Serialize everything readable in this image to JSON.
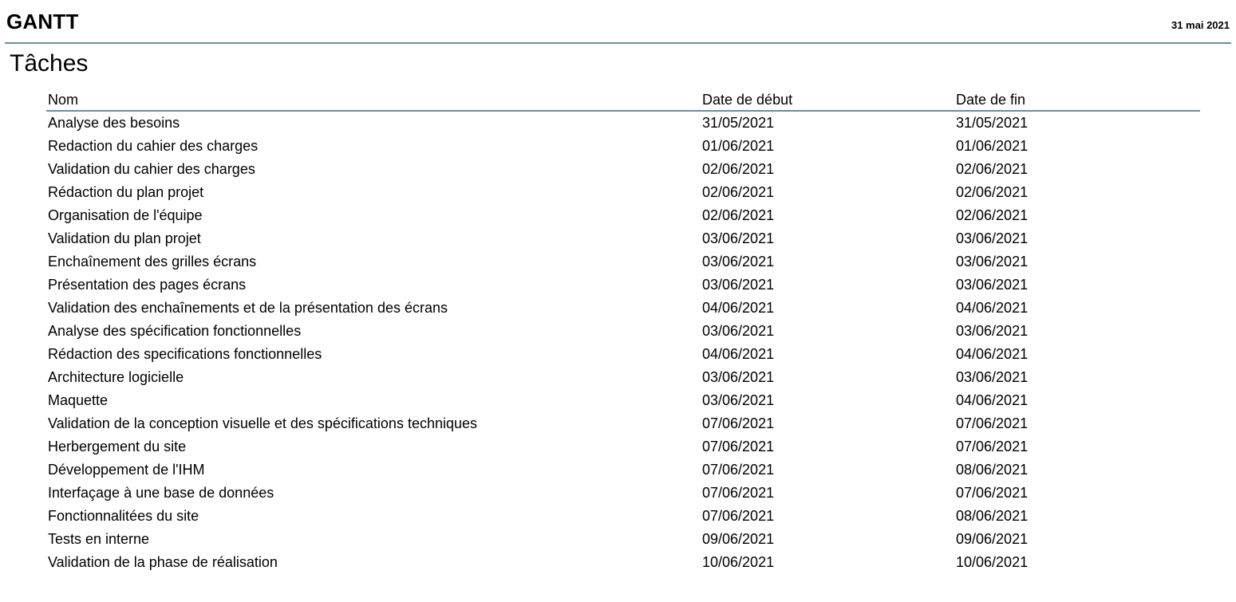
{
  "header": {
    "title": "GANTT",
    "date": "31 mai 2021"
  },
  "section": {
    "title": "Tâches"
  },
  "table": {
    "columns": [
      "Nom",
      "Date de début",
      "Date de fin"
    ],
    "rows": [
      [
        "Analyse des besoins",
        "31/05/2021",
        "31/05/2021"
      ],
      [
        "Redaction du cahier des charges",
        "01/06/2021",
        "01/06/2021"
      ],
      [
        "Validation du cahier des charges",
        "02/06/2021",
        "02/06/2021"
      ],
      [
        "Rédaction du plan projet",
        "02/06/2021",
        "02/06/2021"
      ],
      [
        "Organisation de l'équipe",
        "02/06/2021",
        "02/06/2021"
      ],
      [
        "Validation du plan projet",
        "03/06/2021",
        "03/06/2021"
      ],
      [
        "Enchaînement des grilles écrans",
        "03/06/2021",
        "03/06/2021"
      ],
      [
        "Présentation des pages écrans",
        "03/06/2021",
        "03/06/2021"
      ],
      [
        "Validation des enchaînements et de la présentation des écrans",
        "04/06/2021",
        "04/06/2021"
      ],
      [
        "Analyse des spécification fonctionnelles",
        "03/06/2021",
        "03/06/2021"
      ],
      [
        "Rédaction des specifications fonctionnelles",
        "04/06/2021",
        "04/06/2021"
      ],
      [
        "Architecture logicielle",
        "03/06/2021",
        "03/06/2021"
      ],
      [
        "Maquette",
        "03/06/2021",
        "04/06/2021"
      ],
      [
        "Validation de la conception visuelle et des spécifications techniques",
        "07/06/2021",
        "07/06/2021"
      ],
      [
        "Herbergement du site",
        "07/06/2021",
        "07/06/2021"
      ],
      [
        "Développement de l'IHM",
        "07/06/2021",
        "08/06/2021"
      ],
      [
        "Interfaçage à une base de données",
        "07/06/2021",
        "07/06/2021"
      ],
      [
        "Fonctionnalitées du site",
        "07/06/2021",
        "08/06/2021"
      ],
      [
        "Tests en interne",
        "09/06/2021",
        "09/06/2021"
      ],
      [
        "Validation de la phase de réalisation",
        "10/06/2021",
        "10/06/2021"
      ]
    ]
  },
  "colors": {
    "rule": "#6a8ea5",
    "text": "#000000",
    "background": "#ffffff"
  }
}
